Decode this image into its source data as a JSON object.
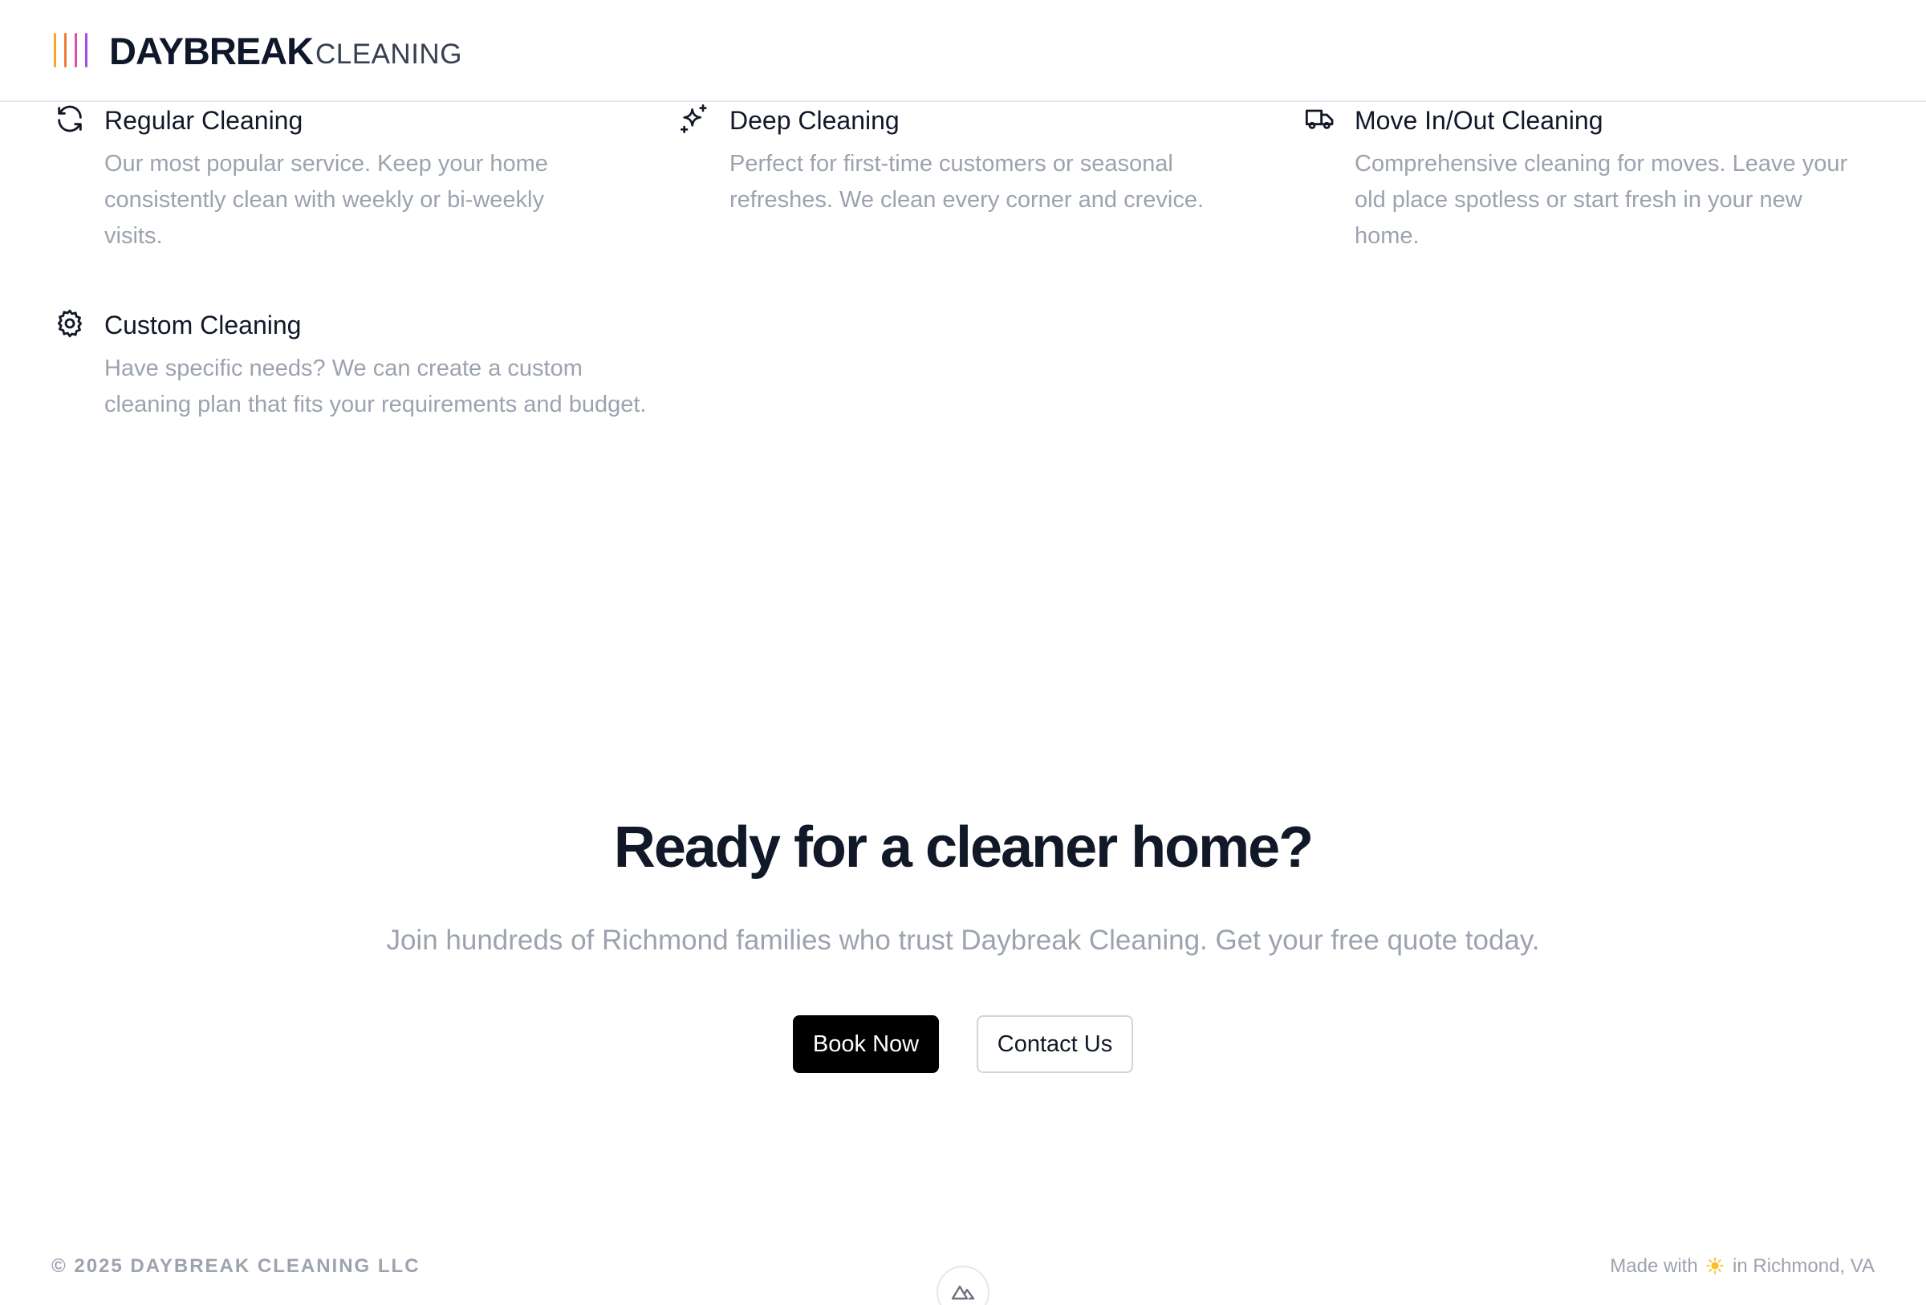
{
  "header": {
    "brand": "DAYBREAK",
    "brand_sub": "CLEANING",
    "logo_colors": [
      "#f5a623",
      "#f07a3a",
      "#e04fa0",
      "#a34de0"
    ]
  },
  "services": [
    {
      "icon": "refresh-icon",
      "title": "Regular Cleaning",
      "description": "Our most popular service. Keep your home consistently clean with weekly or bi-weekly visits."
    },
    {
      "icon": "sparkles-icon",
      "title": "Deep Cleaning",
      "description": "Perfect for first-time customers or seasonal refreshes. We clean every corner and crevice."
    },
    {
      "icon": "truck-icon",
      "title": "Move In/Out Cleaning",
      "description": "Comprehensive cleaning for moves. Leave your old place spotless or start fresh in your new home."
    },
    {
      "icon": "gear-icon",
      "title": "Custom Cleaning",
      "description": "Have specific needs? We can create a custom cleaning plan that fits your requirements and budget."
    }
  ],
  "cta": {
    "title": "Ready for a cleaner home?",
    "subtitle": "Join hundreds of Richmond families who trust Daybreak Cleaning. Get your free quote today.",
    "primary_button": "Book Now",
    "secondary_button": "Contact Us"
  },
  "footer": {
    "copyright": "© 2025 DAYBREAK CLEANING LLC",
    "made_with_prefix": "Made with",
    "made_with_suffix": "in Richmond, VA",
    "sun_icon": "sun-icon"
  }
}
